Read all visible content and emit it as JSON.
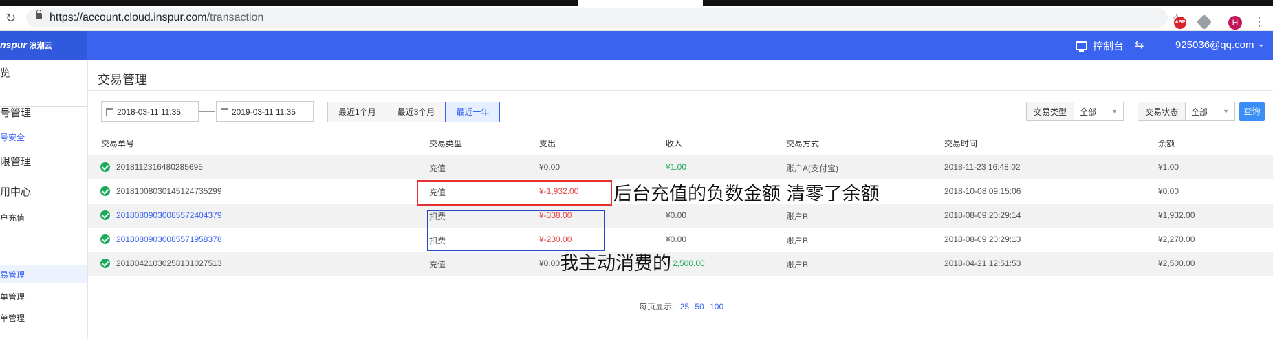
{
  "browser": {
    "url_host": "https://account.cloud.inspur.com",
    "url_path": "/transaction",
    "profile_initial": "H",
    "abp_label": "ABP",
    "icons": [
      "refresh-icon",
      "lock-icon",
      "star-icon",
      "adblock-icon",
      "extension-icon",
      "profile-avatar",
      "kebab-menu-icon"
    ]
  },
  "topbar": {
    "logo": "nspur",
    "logo_cn": "浪潮云",
    "console": "控制台",
    "user": "925036@qq.com",
    "brand_color": "#3a63f0"
  },
  "sidebar": {
    "items": [
      {
        "label": "览"
      },
      {
        "label": "号管理"
      },
      {
        "label": "号安全"
      },
      {
        "label": "限管理"
      },
      {
        "label": "用中心"
      },
      {
        "label": "户充值"
      },
      {
        "label": "易管理"
      },
      {
        "label": "单管理"
      },
      {
        "label": "单管理"
      }
    ]
  },
  "page": {
    "title": "交易管理"
  },
  "filters": {
    "start_date": "2018-03-11 11:35",
    "end_date": "2019-03-11 11:35",
    "ranges": [
      "最近1个月",
      "最近3个月",
      "最近一年"
    ],
    "active_range": "最近一年",
    "type_label": "交易类型",
    "type_value": "全部",
    "status_label": "交易状态",
    "status_value": "全部",
    "search": "查询"
  },
  "table": {
    "headers": [
      "交易单号",
      "交易类型",
      "支出",
      "收入",
      "交易方式",
      "交易时间",
      "余额"
    ],
    "rows": [
      {
        "id": "2018112316480285695",
        "type": "充值",
        "out": "¥0.00",
        "in": "¥1.00",
        "method": "账户A(支付宝)",
        "time": "2018-11-23 16:48:02",
        "balance": "¥1.00"
      },
      {
        "id": "20181008030145124735299",
        "type": "充值",
        "out": "¥-1,932.00",
        "in": "",
        "method": "",
        "time": "2018-10-08 09:15:06",
        "balance": "¥0.00"
      },
      {
        "id": "20180809030085572404379",
        "type": "扣费",
        "out": "¥-338.00",
        "in": "¥0.00",
        "method": "账户B",
        "time": "2018-08-09 20:29:14",
        "balance": "¥1,932.00"
      },
      {
        "id": "20180809030085571958378",
        "type": "扣费",
        "out": "¥-230.00",
        "in": "¥0.00",
        "method": "账户B",
        "time": "2018-08-09 20:29:13",
        "balance": "¥2,270.00"
      },
      {
        "id": "20180421030258131027513",
        "type": "充值",
        "out": "¥0.00",
        "in": "2,500.00",
        "method": "账户B",
        "time": "2018-04-21 12:51:53",
        "balance": "¥2,500.00"
      }
    ]
  },
  "pager": {
    "label": "每页显示:",
    "options": [
      "25",
      "50",
      "100"
    ]
  },
  "annotations": {
    "red_note": "后台充值的负数金额 清零了余额",
    "blue_note": "我主动消费的",
    "red_color": "#e83030",
    "blue_color": "#2347c7"
  }
}
